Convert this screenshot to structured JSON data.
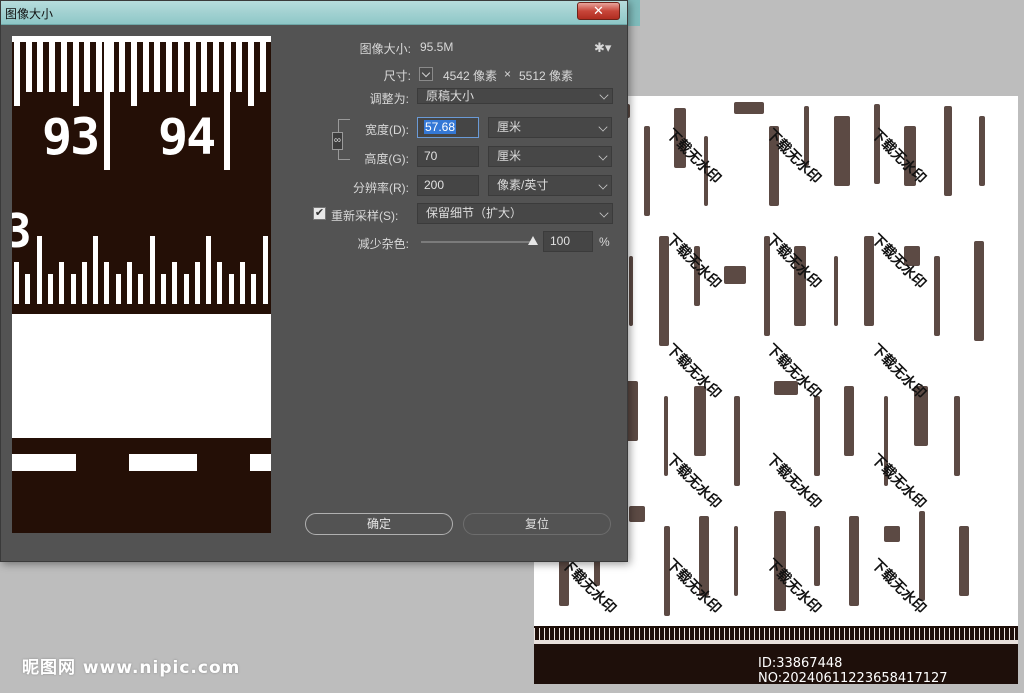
{
  "window": {
    "title": "图像大小",
    "close_label": "✕"
  },
  "form": {
    "image_size_label": "图像大小:",
    "image_size_value": "95.5M",
    "dimensions_label": "尺寸:",
    "dimensions_width": "4542 像素",
    "dimensions_sep": "×",
    "dimensions_height": "5512 像素",
    "fit_to_label": "调整为:",
    "fit_to_value": "原稿大小",
    "width_label": "宽度(D):",
    "width_value": "57.68",
    "width_unit": "厘米",
    "height_label": "高度(G):",
    "height_value": "70",
    "height_unit": "厘米",
    "resolution_label": "分辨率(R):",
    "resolution_value": "200",
    "resolution_unit": "像素/英寸",
    "resample_label": "重新采样(S):",
    "resample_checked": "✔",
    "resample_value": "保留细节（扩大）",
    "noise_label": "减少杂色:",
    "noise_value": "100",
    "noise_unit": "%",
    "noise_level": 1.0
  },
  "buttons": {
    "ok": "确定",
    "reset": "复位"
  },
  "preview": {
    "numbers": [
      "93",
      "94"
    ],
    "partial_number": "3"
  },
  "background_doc": {
    "watermark": "下载无水印",
    "id_text": "ID:33867448 NO:20240611223658417127"
  },
  "site_logo": "昵图网 www.nipic.com"
}
